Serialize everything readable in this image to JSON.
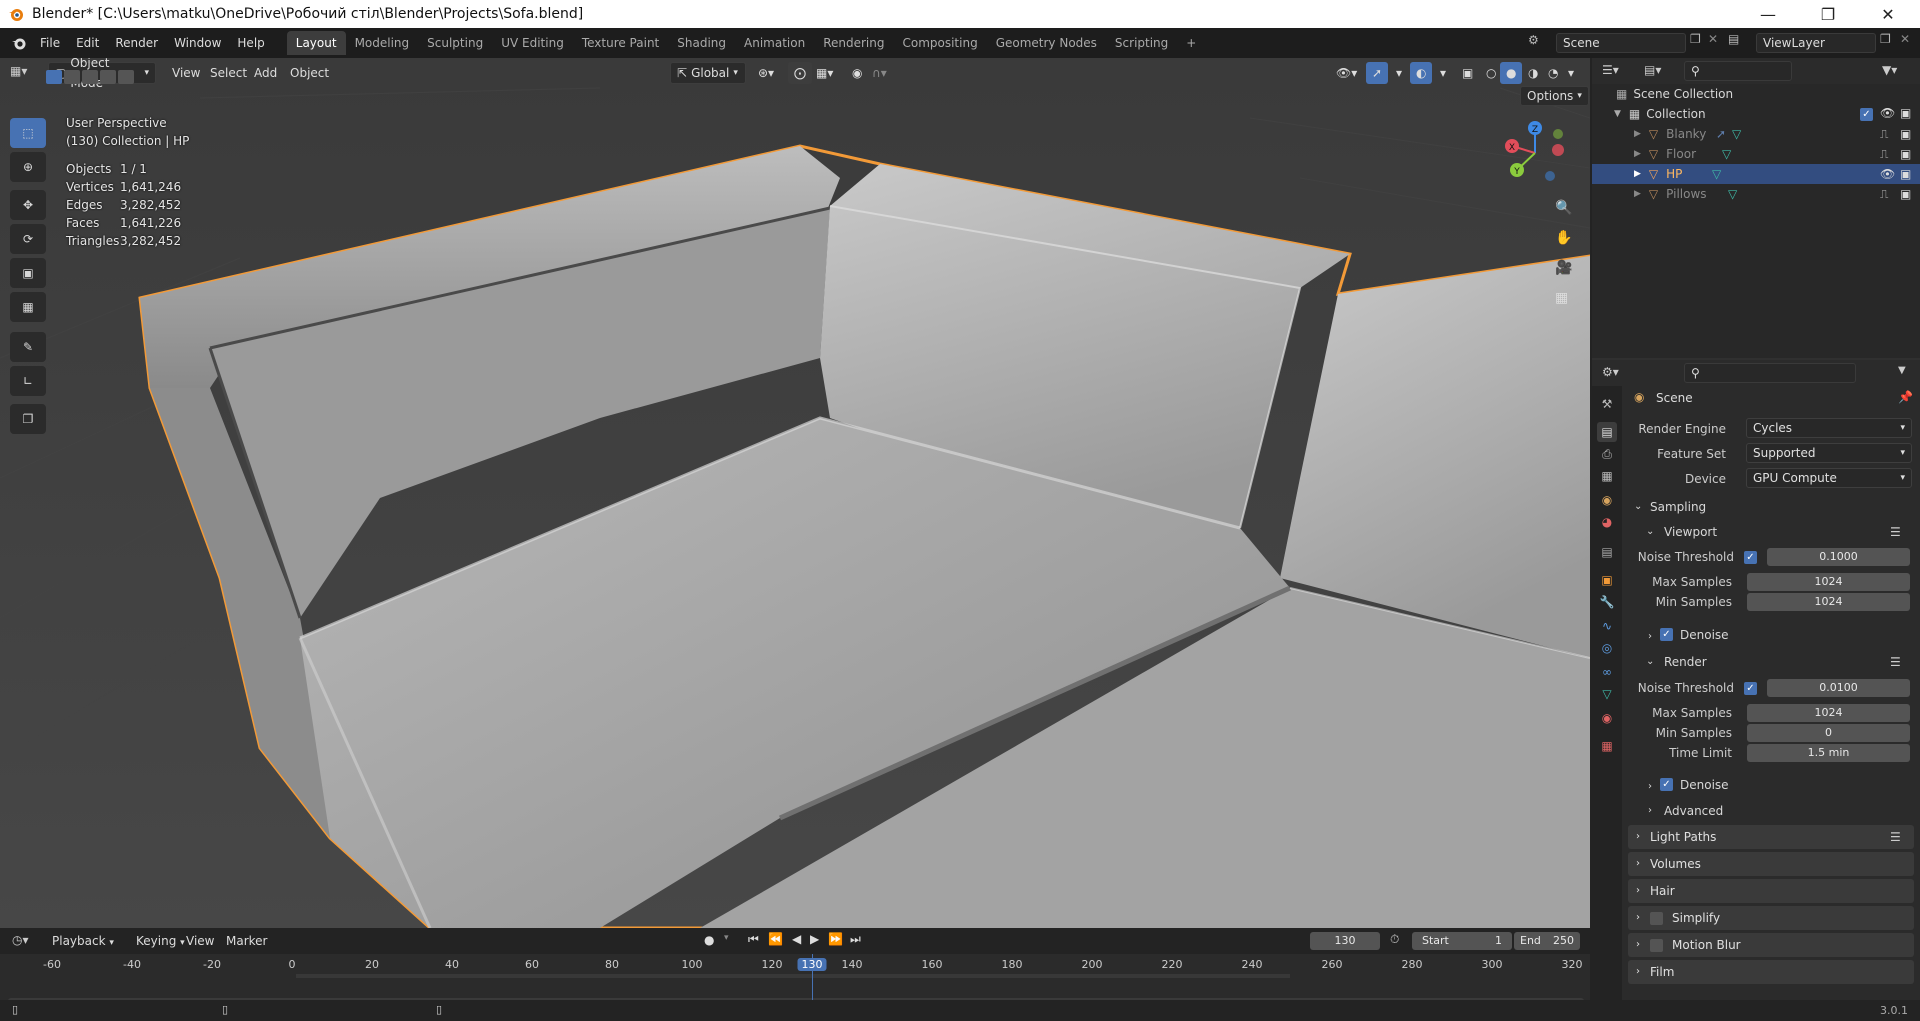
{
  "window": {
    "title": "Blender* [C:\\Users\\matku\\OneDrive\\Робочий стіл\\Blender\\Projects\\Sofa.blend]"
  },
  "menu": [
    "File",
    "Edit",
    "Render",
    "Window",
    "Help"
  ],
  "workspaces": [
    "Layout",
    "Modeling",
    "Sculpting",
    "UV Editing",
    "Texture Paint",
    "Shading",
    "Animation",
    "Rendering",
    "Compositing",
    "Geometry Nodes",
    "Scripting"
  ],
  "scene_name": "Scene",
  "view_layer": "ViewLayer",
  "viewport": {
    "mode": "Object Mode",
    "menus": [
      "View",
      "Select",
      "Add",
      "Object"
    ],
    "transform_orientation": "Global",
    "options_label": "Options",
    "overlay_title": "User Perspective",
    "overlay_sub": "(130) Collection | HP",
    "stats": [
      {
        "label": "Objects",
        "value": "1 / 1"
      },
      {
        "label": "Vertices",
        "value": "1,641,246"
      },
      {
        "label": "Edges",
        "value": "3,282,452"
      },
      {
        "label": "Faces",
        "value": "1,641,226"
      },
      {
        "label": "Triangles",
        "value": "3,282,452"
      }
    ],
    "gizmo": {
      "x": "X",
      "y": "Y",
      "z": "Z"
    },
    "colors": {
      "accent": "#4772b3",
      "outline": "#f29a38",
      "x_axis": "#e24d5a",
      "y_axis": "#8bcb3d",
      "z_axis": "#3e8ae6"
    }
  },
  "outliner": {
    "root": "Scene Collection",
    "collection": "Collection",
    "objects": [
      "Blanky",
      "Floor",
      "HP",
      "Pillows"
    ],
    "selected": "HP"
  },
  "properties": {
    "context": "Scene",
    "render_engine_label": "Render Engine",
    "render_engine": "Cycles",
    "feature_set_label": "Feature Set",
    "feature_set": "Supported",
    "device_label": "Device",
    "device": "GPU Compute",
    "sampling": "Sampling",
    "viewport": {
      "title": "Viewport",
      "noise_threshold_label": "Noise Threshold",
      "noise_threshold": "0.1000",
      "max_samples_label": "Max Samples",
      "max_samples": "1024",
      "min_samples_label": "Min Samples",
      "min_samples": "1024",
      "denoise": "Denoise"
    },
    "render": {
      "title": "Render",
      "noise_threshold_label": "Noise Threshold",
      "noise_threshold": "0.0100",
      "max_samples_label": "Max Samples",
      "max_samples": "1024",
      "min_samples_label": "Min Samples",
      "min_samples": "0",
      "time_limit_label": "Time Limit",
      "time_limit": "1.5 min",
      "denoise": "Denoise"
    },
    "advanced": "Advanced",
    "panels": [
      "Light Paths",
      "Volumes",
      "Hair",
      "Simplify",
      "Motion Blur",
      "Film"
    ]
  },
  "timeline": {
    "menus": [
      "Playback",
      "Keying",
      "View",
      "Marker"
    ],
    "current_frame": "130",
    "start_label": "Start",
    "start": "1",
    "end_label": "End",
    "end": "250",
    "ticks": [
      "-60",
      "-40",
      "-20",
      "0",
      "20",
      "40",
      "60",
      "80",
      "100",
      "120",
      "130",
      "140",
      "160",
      "180",
      "200",
      "220",
      "240",
      "260",
      "280",
      "300",
      "320"
    ]
  },
  "version": "3.0.1"
}
